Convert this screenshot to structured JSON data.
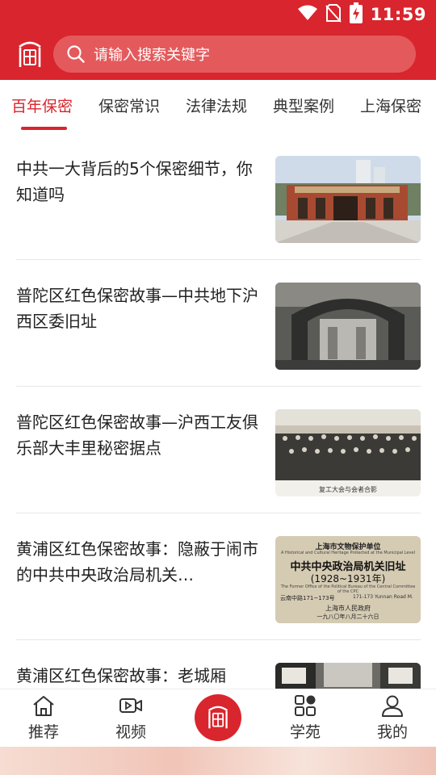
{
  "status_bar": {
    "time": "11:59",
    "icons": [
      "wifi-icon",
      "no-sim-icon",
      "battery-charging-icon"
    ]
  },
  "header": {
    "logo_icon": "security-seal-logo",
    "search": {
      "placeholder": "请输入搜索关键字",
      "icon": "search-icon"
    }
  },
  "tabs": [
    {
      "label": "百年保密",
      "active": true
    },
    {
      "label": "保密常识"
    },
    {
      "label": "法律法规"
    },
    {
      "label": "典型案例"
    },
    {
      "label": "上海保密"
    }
  ],
  "articles": [
    {
      "title": "中共一大背后的5个保密细节，你知道吗",
      "thumb": "red-brick-memorial-hall-photo"
    },
    {
      "title": "普陀区红色保密故事—中共地下沪西区委旧址",
      "thumb": "old-alley-archway-photo"
    },
    {
      "title": "普陀区红色保密故事—沪西工友俱乐部大丰里秘密据点",
      "thumb": "group-photo",
      "thumb_caption": "复工大会与会者合影"
    },
    {
      "title": "黄浦区红色保密故事：隐蔽于闹市的中共中央政治局机关…",
      "thumb": "heritage-plaque-photo",
      "plaque": {
        "top": "上海市文物保护单位",
        "english_top": "A Historical and Cultural Heritage Protected at the Municipal Level",
        "name": "中共中央政治局机关旧址",
        "years": "(1928~1931年)",
        "english": "The Former Office of the Political Bureau of the Central Committee of the CPC",
        "address": "云南中路171~173号",
        "address_en": "171-173 Yunnan Road M.",
        "issuer": "上海市人民政府",
        "date": "一九八〇年八月二十六日"
      }
    },
    {
      "title": "黄浦区红色保密故事：老城厢",
      "thumb": "old-street-photo"
    }
  ],
  "bottom_nav": [
    {
      "label": "推荐",
      "icon": "home-icon"
    },
    {
      "label": "视频",
      "icon": "video-icon"
    },
    {
      "label": "",
      "icon": "center-seal-button"
    },
    {
      "label": "学苑",
      "icon": "grid-icon"
    },
    {
      "label": "我的",
      "icon": "user-icon"
    }
  ],
  "colors": {
    "brand_red": "#d9252d",
    "search_bg": "#e45a5c",
    "text": "#222222"
  }
}
